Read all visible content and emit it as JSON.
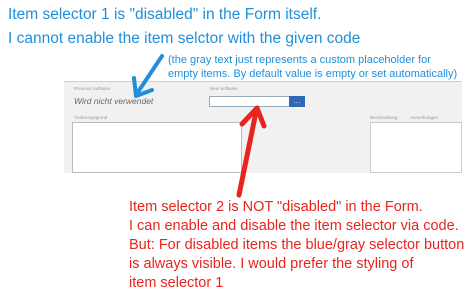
{
  "annotations": {
    "blue_line_1": "Item selector 1 is \"disabled\" in the Form itself.",
    "blue_line_2": "I cannot enable the item selctor with the given code",
    "blue_small_line_1": "(the gray text just represents a custom placeholder for",
    "blue_small_line_2": "empty items. By default value is empty or set automatically)",
    "red_line_1": "Item selector 2 is NOT \"disabled\" in the Form.",
    "red_line_2": "I can enable and disable the item selector via code.",
    "red_line_3": "But: For disabled items the blue/gray selector button",
    "red_line_4": "is always visible. I would prefer the styling of",
    "red_line_5": "item selector 1"
  },
  "form": {
    "field1_label": "Previous Software",
    "field1_placeholder": "Wird nicht verwendet",
    "field2_label": "New Software",
    "field2_value": "",
    "selector_button_label": "...",
    "textarea1_label": "Änderungsgrund",
    "textarea2_label": "Beschreibung",
    "textarea3_label": "Anmerkungen"
  },
  "colors": {
    "blue_note": "#1f8fdc",
    "red_note": "#e8251d",
    "selector_button": "#2f69b5"
  },
  "icons": {
    "blue_arrow": "arrow-down-left-icon",
    "red_arrow": "arrow-up-icon"
  }
}
